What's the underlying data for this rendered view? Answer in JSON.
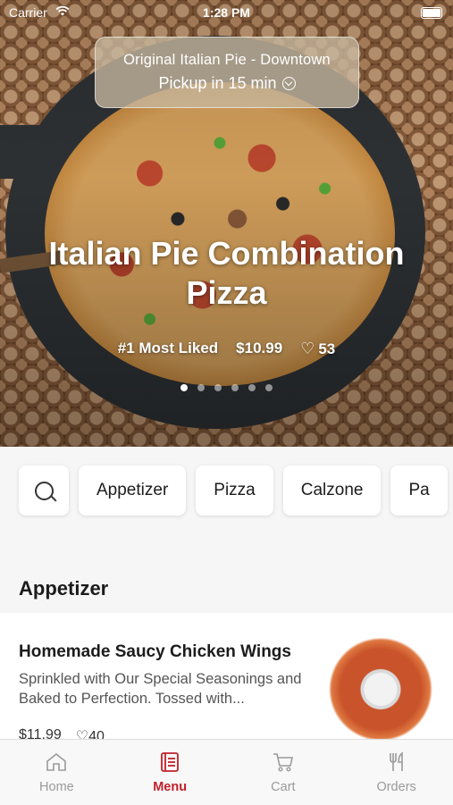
{
  "status_bar": {
    "carrier": "Carrier",
    "time": "1:28 PM"
  },
  "store": {
    "name": "Original Italian Pie - Downtown",
    "pickup": "Pickup in 15 min"
  },
  "hero": {
    "title": "Italian Pie Combination Pizza",
    "badge": "#1 Most Liked",
    "price": "$10.99",
    "likes": "53",
    "carousel_pages": 6,
    "carousel_active": 1
  },
  "categories": [
    "Appetizer",
    "Pizza",
    "Calzone",
    "Pa"
  ],
  "section_title": "Appetizer",
  "item": {
    "name": "Homemade Saucy Chicken Wings",
    "description": "Sprinkled with Our Special Seasonings and Baked to Perfection. Tossed with...",
    "price": "$11.99",
    "likes": "40"
  },
  "tabs": [
    {
      "label": "Home",
      "icon": "home-icon"
    },
    {
      "label": "Menu",
      "icon": "menu-icon"
    },
    {
      "label": "Cart",
      "icon": "cart-icon"
    },
    {
      "label": "Orders",
      "icon": "fork-knife-icon"
    }
  ],
  "colors": {
    "accent": "#c0202a",
    "inactive": "#9a9a9a"
  }
}
